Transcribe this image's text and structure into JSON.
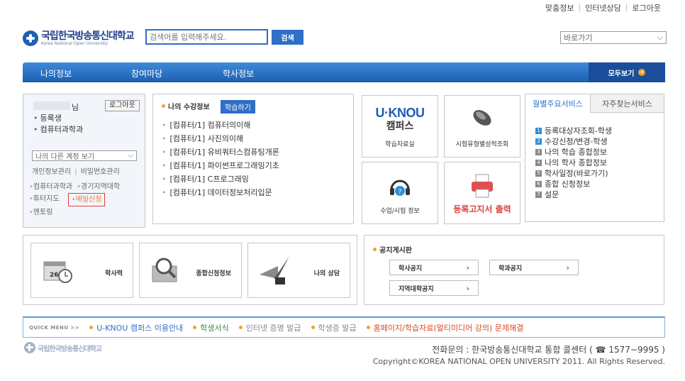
{
  "util": [
    "맞춤정보",
    "인터넷상담",
    "로그아웃"
  ],
  "logo": {
    "ko": "국립한국방송통신대학교",
    "en": "Korea National Open University"
  },
  "search": {
    "placeholder": "검색어를 입력해주세요.",
    "button": "검색"
  },
  "goto": {
    "label": "바로가기"
  },
  "gnb": {
    "items": [
      "나의정보",
      "참여마당",
      "학사정보"
    ],
    "all": "모두보기"
  },
  "profile": {
    "suffix": "님",
    "logout": "로그아웃",
    "status": "등록생",
    "major": "컴퓨터과학과",
    "account_select": "나의 다른 계정 보기",
    "mgmt": [
      "개인정보관리",
      "비밀번호관리"
    ],
    "links": [
      "컴퓨터과학과",
      "경기지역대학",
      "튜터지도",
      "메일신청",
      "멘토링"
    ]
  },
  "course": {
    "title": "나의 수강정보",
    "study_button": "학습하기",
    "items": [
      "[컴퓨터/1] 컴퓨터의이해",
      "[컴퓨터/1] 사진의이해",
      "[컴퓨터/1] 유비쿼터스컴퓨팅개론",
      "[컴퓨터/1] 파이썬프로그래밍기초",
      "[컴퓨터/1] C프로그래밍",
      "[컴퓨터/1] 데이터정보처리입문"
    ]
  },
  "tiles": {
    "uknou_brand": "U·KNOU",
    "uknou_sub": "캠퍼스",
    "uknou_label": "학습자료실",
    "exam_type": "시험유형별성적조회",
    "class_exam": "수업/시험 정보",
    "register_print": "등록고지서 출력"
  },
  "services": {
    "tabs": [
      "월별주요서비스",
      "자주찾는서비스"
    ],
    "items": [
      "등록대상자조회-학생",
      "수강신청/변경-학생",
      "나의 학습 종합정보",
      "나의 학사 종합정보",
      "학사일정(바로가기)",
      "종합 신청정보",
      "설문"
    ]
  },
  "quick": [
    "학사력",
    "종합신청정보",
    "나의 상담"
  ],
  "board": {
    "title": "공지게시판",
    "buttons": [
      "학사공지",
      "학과공지",
      "지역대학공지"
    ]
  },
  "quickmenu": {
    "title": "QUICK MENU",
    "arrow": ">>",
    "items": [
      "U-KNOU 캠퍼스 이용안내",
      "학생서식",
      "인터넷 증명 발급",
      "학생증 발급",
      "홈페이지/학습자료(멀티미디어 강의) 문제해결"
    ]
  },
  "footer": {
    "contact": "전화문의 : 한국방송통신대학교 통합 콜센터 ( ☎ 1577−9995 )",
    "copyright": "Copyright©KOREA NATIONAL OPEN UNIVERSITY 2011. All Rights Reserved."
  },
  "colors": {
    "primary": "#2e6fc7",
    "gnb": "#1c5fb3",
    "accent": "#f0a032",
    "alert": "#e04040"
  }
}
